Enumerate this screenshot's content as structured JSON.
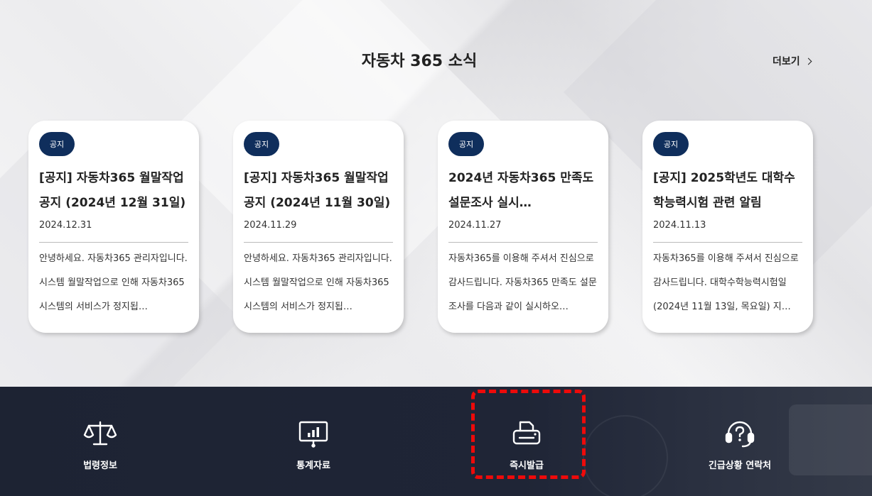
{
  "section": {
    "title": "자동차 365 소식",
    "more_label": "더보기"
  },
  "cards": [
    {
      "badge": "공지",
      "title": "[공지] 자동차365 월말작업 공지 (2024년 12월 31일)",
      "date": "2024.12.31",
      "body": "안녕하세요. 자동차365 관리자입니다. 시스템 월말작업으로 인해 자동차365 시스템의 서비스가 정지됩…"
    },
    {
      "badge": "공지",
      "title": "[공지] 자동차365 월말작업 공지 (2024년 11월 30일)",
      "date": "2024.11.29",
      "body": "안녕하세요. 자동차365 관리자입니다. 시스템 월말작업으로 인해 자동차365 시스템의 서비스가 정지됩…"
    },
    {
      "badge": "공지",
      "title": "2024년 자동차365 만족도 설문조사 실시…",
      "date": "2024.11.27",
      "body": "자동차365를 이용해 주셔서 진심으로 감사드립니다. 자동차365 만족도 설문조사를 다음과 같이 실시하오…"
    },
    {
      "badge": "공지",
      "title": "[공지] 2025학년도 대학수학능력시험 관련 알림",
      "date": "2024.11.13",
      "body": "자동차365를 이용해 주셔서 진심으로 감사드립니다. 대학수학능력시험일(2024년 11월 13일, 목요일) 지…"
    }
  ],
  "quick_links": [
    {
      "label": "법령정보",
      "icon": "scale-icon"
    },
    {
      "label": "통계자료",
      "icon": "chart-board-icon"
    },
    {
      "label": "즉시발급",
      "icon": "printer-icon"
    },
    {
      "label": "긴급상황 연락처",
      "icon": "headset-question-icon"
    }
  ],
  "colors": {
    "badge": "#0f2e5c",
    "footer_bg": "#1d2333",
    "highlight": "#ee0a0a"
  }
}
